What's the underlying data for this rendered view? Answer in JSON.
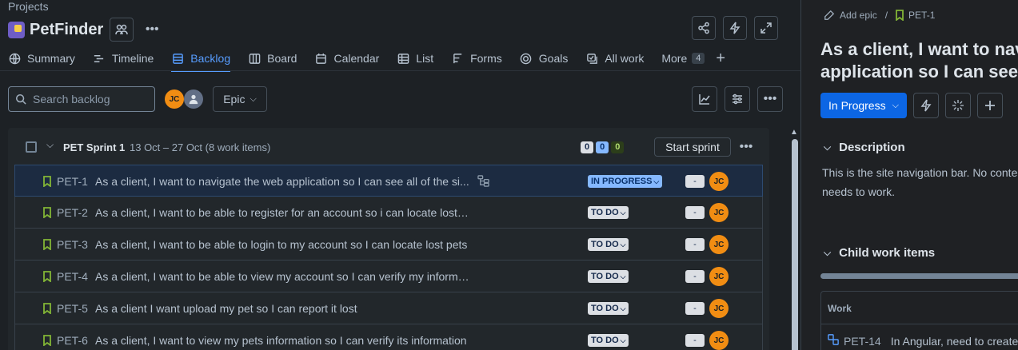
{
  "breadcrumb": "Projects",
  "project": {
    "name": "PetFinder"
  },
  "tabs": [
    {
      "label": "Summary",
      "icon": "globe-icon"
    },
    {
      "label": "Timeline",
      "icon": "timeline-icon"
    },
    {
      "label": "Backlog",
      "icon": "backlog-icon",
      "active": true
    },
    {
      "label": "Board",
      "icon": "board-icon"
    },
    {
      "label": "Calendar",
      "icon": "calendar-icon"
    },
    {
      "label": "List",
      "icon": "list-icon"
    },
    {
      "label": "Forms",
      "icon": "forms-icon"
    },
    {
      "label": "Goals",
      "icon": "goals-icon"
    },
    {
      "label": "All work",
      "icon": "all-work-icon"
    }
  ],
  "more": {
    "label": "More",
    "count": "4"
  },
  "search": {
    "placeholder": "Search backlog"
  },
  "avatar_initials": "JC",
  "epic_filter": "Epic",
  "sprint": {
    "name": "PET Sprint 1",
    "dates": "13 Oct – 27 Oct (8 work items)",
    "count_todo": "0",
    "count_inprogress": "0",
    "count_done": "0",
    "start_label": "Start sprint"
  },
  "items": [
    {
      "key": "PET-1",
      "summary": "As a client, I want to navigate the web application so I can see all of the si...",
      "status": "IN PROGRESS",
      "estimate": "-",
      "assignee": "JC",
      "selected": true,
      "has_children": true
    },
    {
      "key": "PET-2",
      "summary": "As a client, I want to be able to register for an account so i can locate lost pets",
      "status": "TO DO",
      "estimate": "-",
      "assignee": "JC"
    },
    {
      "key": "PET-3",
      "summary": "As a client, I want to be able to login to my account so I can locate lost pets",
      "status": "TO DO",
      "estimate": "-",
      "assignee": "JC"
    },
    {
      "key": "PET-4",
      "summary": "As a client, I want to be able to view my account so I can verify my information",
      "status": "TO DO",
      "estimate": "-",
      "assignee": "JC"
    },
    {
      "key": "PET-5",
      "summary": "As a client I want upload my pet so I can report it lost",
      "status": "TO DO",
      "estimate": "-",
      "assignee": "JC"
    },
    {
      "key": "PET-6",
      "summary": "As a client, I want to view my pets information so I can verify its information",
      "status": "TO DO",
      "estimate": "-",
      "assignee": "JC"
    }
  ],
  "detail": {
    "add_epic": "Add epic",
    "key": "PET-1",
    "title": "As a client, I want to navigate the web application so I can see all of the sites",
    "status_button": "In Progress",
    "description_heading": "Description",
    "description": "This is the site navigation bar. No content needs to work.",
    "child_heading": "Child work items",
    "table_header": "Work",
    "child_key": "PET-14",
    "child_summary": "In Angular, need to create"
  },
  "colors": {
    "accent": "#579dff",
    "primary_button": "#0c66e4",
    "avatar": "#f18d13",
    "story_icon": "#82b536"
  }
}
